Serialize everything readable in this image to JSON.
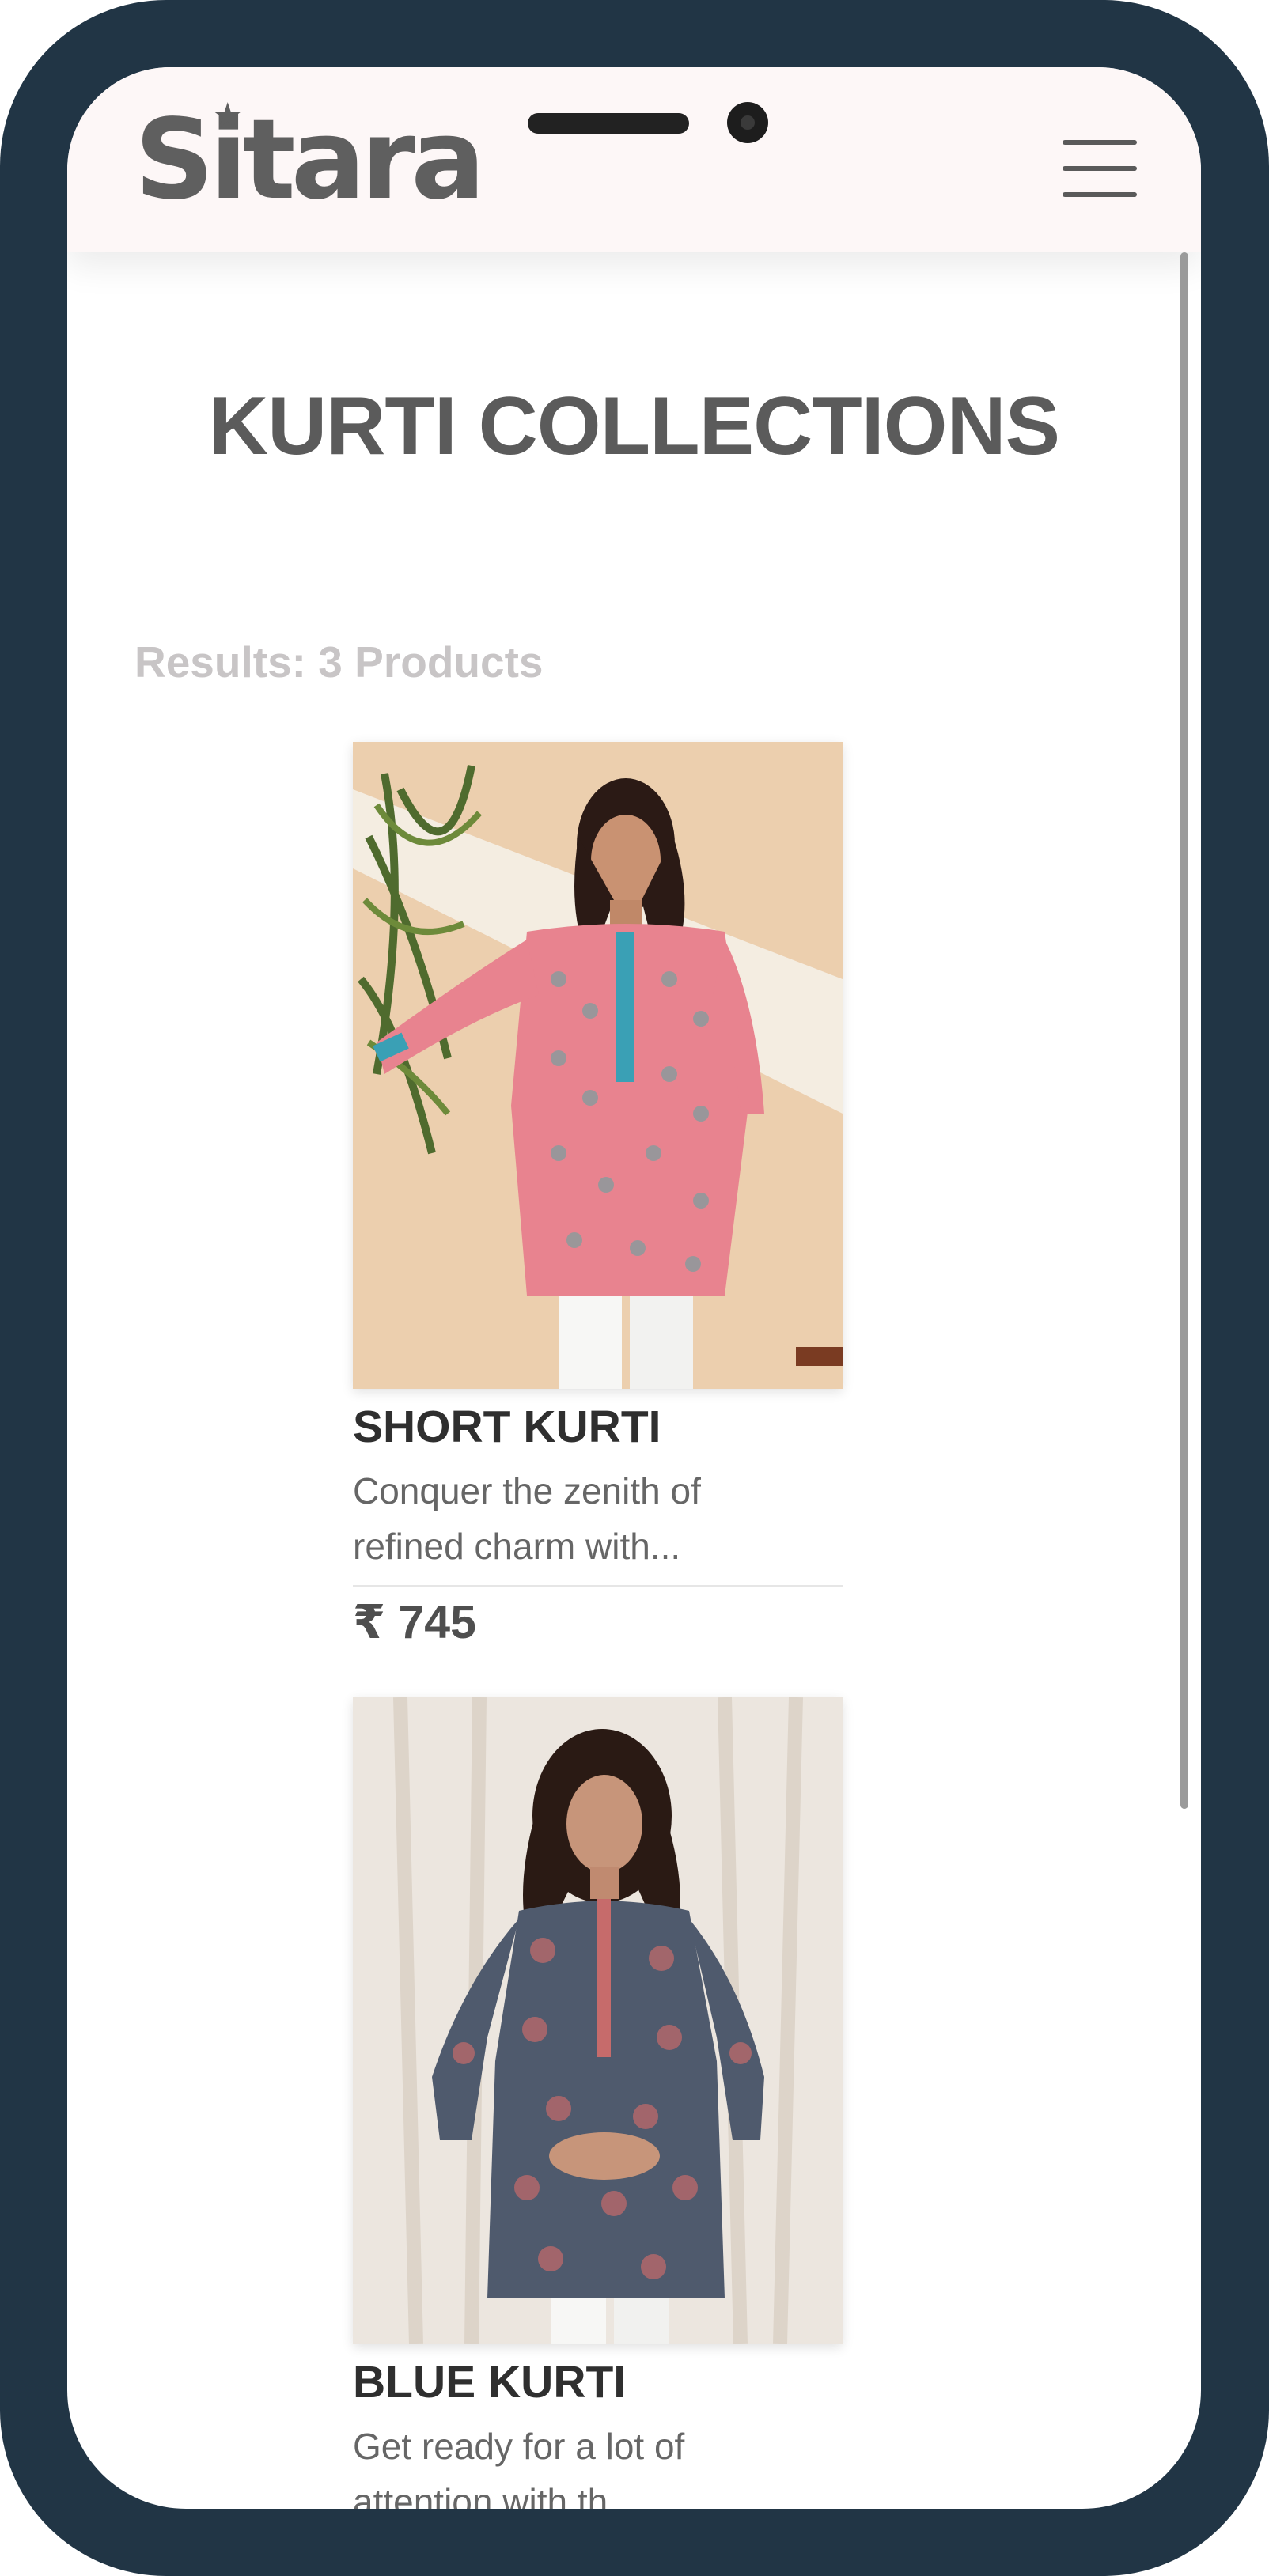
{
  "brand": {
    "logo_text": "Sitara",
    "logo_star": "★"
  },
  "header": {
    "menu_icon": "hamburger-menu-icon"
  },
  "page": {
    "title": "KURTI COLLECTIONS",
    "results_text": "Results: 3 Products"
  },
  "products": [
    {
      "name": "SHORT KURTI",
      "description": "Conquer the zenith of refined charm with...",
      "price": "₹ 745",
      "image_colors": {
        "background": "#e8c9a6",
        "garment": "#e8838f",
        "accent": "#3aa0b5"
      }
    },
    {
      "name": "BLUE KURTI",
      "description": "Get ready for a lot of attention with th...",
      "price": "",
      "image_colors": {
        "background": "#ece6df",
        "garment": "#4f5a6d",
        "accent": "#c66b6b"
      }
    }
  ],
  "colors": {
    "device_frame": "#213545",
    "header_bg": "#fdf7f7",
    "title": "#5b5b5b",
    "results": "#c8c5c6"
  }
}
